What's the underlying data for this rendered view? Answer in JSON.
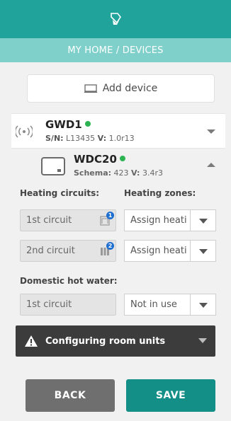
{
  "header": {
    "icon": "tag-hand-icon",
    "subtitle": "MY HOME / DEVICES"
  },
  "add_device": {
    "label": "Add device",
    "icon": "monitor-icon"
  },
  "gateway": {
    "name": "GWD1",
    "status_color": "#2db352",
    "sn_label": "S/N:",
    "sn_value": "L13435",
    "v_label": "V:",
    "v_value": "1.0r13",
    "icon": "wireless-signal-icon"
  },
  "controller": {
    "name": "WDC20",
    "status_color": "#2db352",
    "schema_label": "Schema:",
    "schema_value": "423",
    "v_label": "V:",
    "v_value": "3.4r3",
    "icon": "controller-device-icon"
  },
  "heating": {
    "circuits_label": "Heating circuits:",
    "zones_label": "Heating zones:",
    "rows": [
      {
        "circuit": "1st circuit",
        "badge": "1",
        "zone": "Assign heati"
      },
      {
        "circuit": "2nd circuit",
        "badge": "2",
        "zone": "Assign heati"
      }
    ]
  },
  "dhw": {
    "label": "Domestic hot water:",
    "circuit": "1st circuit",
    "mode": "Not in use"
  },
  "room_units": {
    "label": "Configuring room units",
    "icon": "warning-icon"
  },
  "actions": {
    "back": "BACK",
    "save": "SAVE"
  },
  "colors": {
    "primary": "#1fa39a",
    "subbar": "#7fd0ca",
    "save": "#148f87",
    "back": "#6f6f6f",
    "dark_bar": "#3c3c3c"
  }
}
